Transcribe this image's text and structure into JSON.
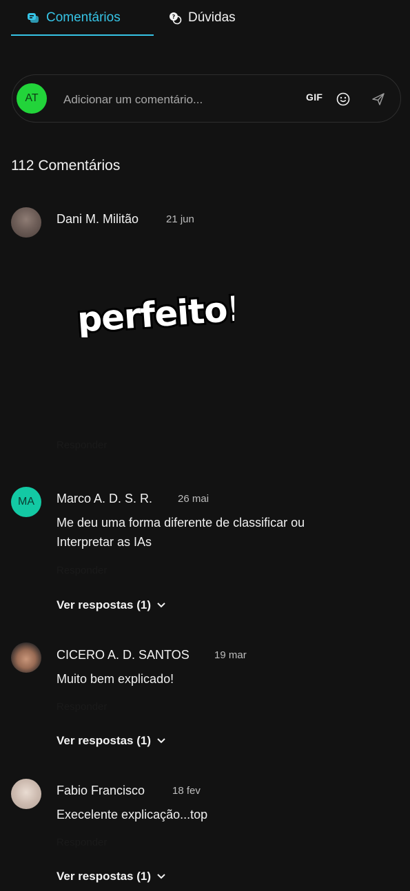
{
  "tabs": [
    {
      "label": "Comentários",
      "icon": "chat-bubbles-icon",
      "active": true
    },
    {
      "label": "Dúvidas",
      "icon": "question-bubbles-icon",
      "active": false
    }
  ],
  "composer": {
    "avatar_initials": "AT",
    "placeholder": "Adicionar um comentário...",
    "gif_label": "GIF",
    "emoji_icon": "smiley-icon",
    "send_icon": "send-icon"
  },
  "comments_heading": "112 Comentários",
  "comments": [
    {
      "author": "Dani M. Militão",
      "date": "21 jun",
      "body": "",
      "gif_text": "perfeito!",
      "reply_label": "Responder",
      "view_replies": ""
    },
    {
      "author": "Marco A. D. S. R.",
      "date": "26 mai",
      "avatar_initials": "MA",
      "body_lines": [
        "Me deu uma forma diferente de classificar ou",
        "Interpretar as IAs"
      ],
      "reply_label": "Responder",
      "view_replies": "Ver respostas (1)"
    },
    {
      "author": "CICERO A. D. SANTOS",
      "date": "19 mar",
      "body": "Muito bem explicado!",
      "reply_label": "Responder",
      "view_replies": "Ver respostas (1)"
    },
    {
      "author": "Fabio Francisco",
      "date": "18 fev",
      "body": "Execelente explicação...top",
      "reply_label": "Responder",
      "view_replies": "Ver respostas (1)"
    }
  ],
  "colors": {
    "accent": "#36c4e6",
    "background": "#121212",
    "user_avatar": "#22d43a",
    "ma_avatar": "#13c9a4"
  }
}
